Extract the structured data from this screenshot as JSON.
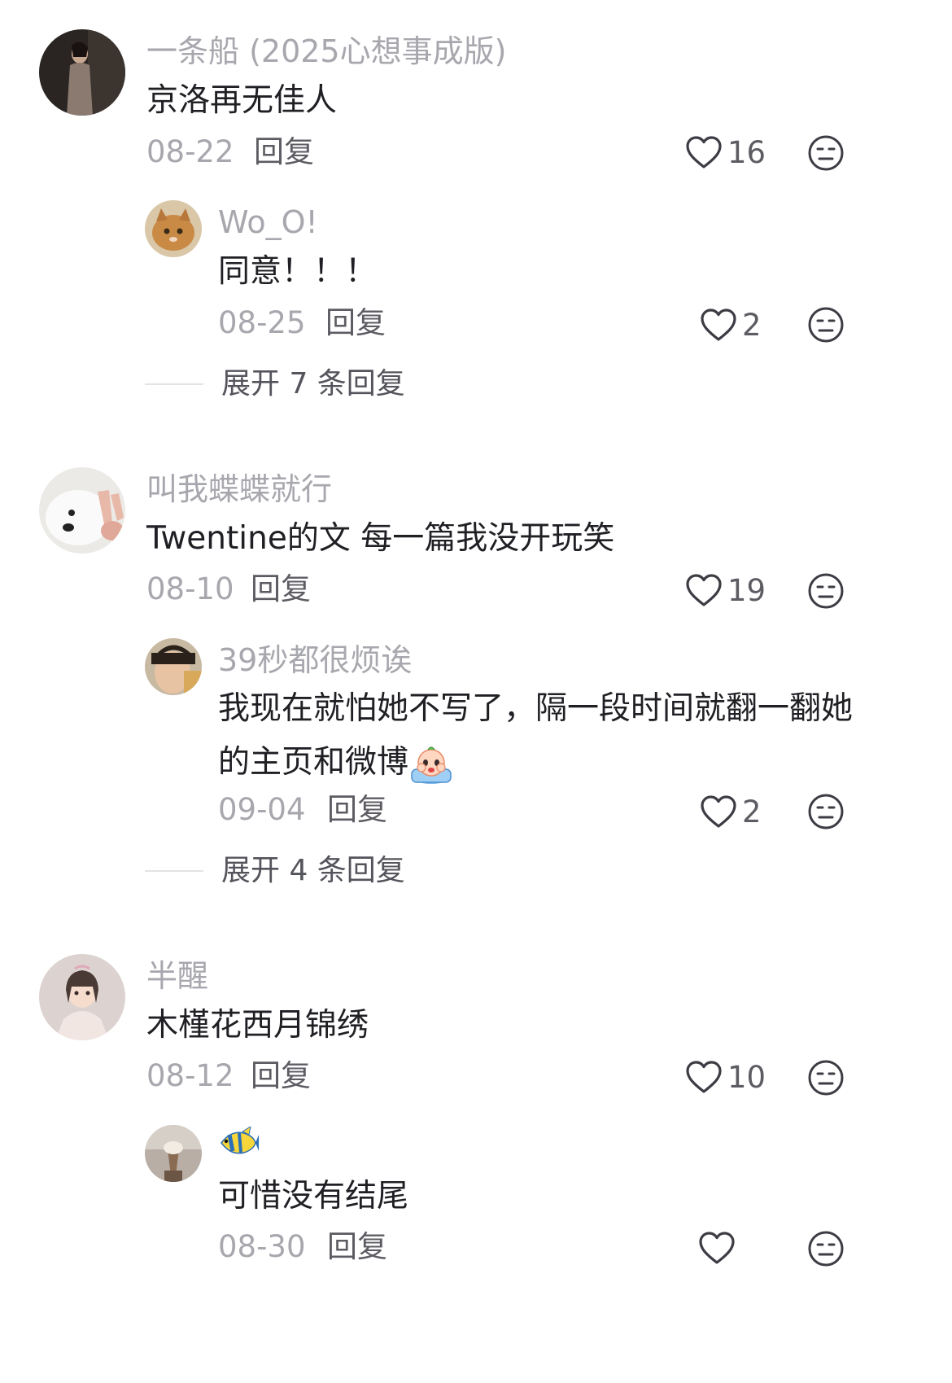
{
  "comments": [
    {
      "username": "一条船 (2025心想事成版)",
      "text": "京洛再无佳人",
      "date": "08-22",
      "reply_label": "回复",
      "likes": "16",
      "reply": {
        "username": "Wo_O!",
        "text": "同意！！！",
        "date": "08-25",
        "reply_label": "回复",
        "likes": "2"
      },
      "expand_label": "展开 7 条回复"
    },
    {
      "username": "叫我蝶蝶就行",
      "text": "Twentine的文 每一篇我没开玩笑",
      "date": "08-10",
      "reply_label": "回复",
      "likes": "19",
      "reply": {
        "username": "39秒都很烦诶",
        "text": "我现在就怕她不写了，隔一段时间就翻一翻她的主页和微博",
        "date": "09-04",
        "reply_label": "回复",
        "likes": "2"
      },
      "expand_label": "展开 4 条回复"
    },
    {
      "username": "半醒",
      "text": "木槿花西月锦绣",
      "date": "08-12",
      "reply_label": "回复",
      "likes": "10",
      "reply": {
        "username_icon": "tropical-fish-emoji",
        "text": "可惜没有结尾",
        "date": "08-30",
        "reply_label": "回复",
        "likes": ""
      }
    }
  ],
  "icons": {
    "like": "heart-outline-icon",
    "dislike": "neutral-face-icon",
    "crying": "crying-face-emoji"
  },
  "colors": {
    "username": "#a7a7ae",
    "text": "#1f1f24",
    "meta": "#a7a7ae",
    "action": "#5c5c63"
  }
}
